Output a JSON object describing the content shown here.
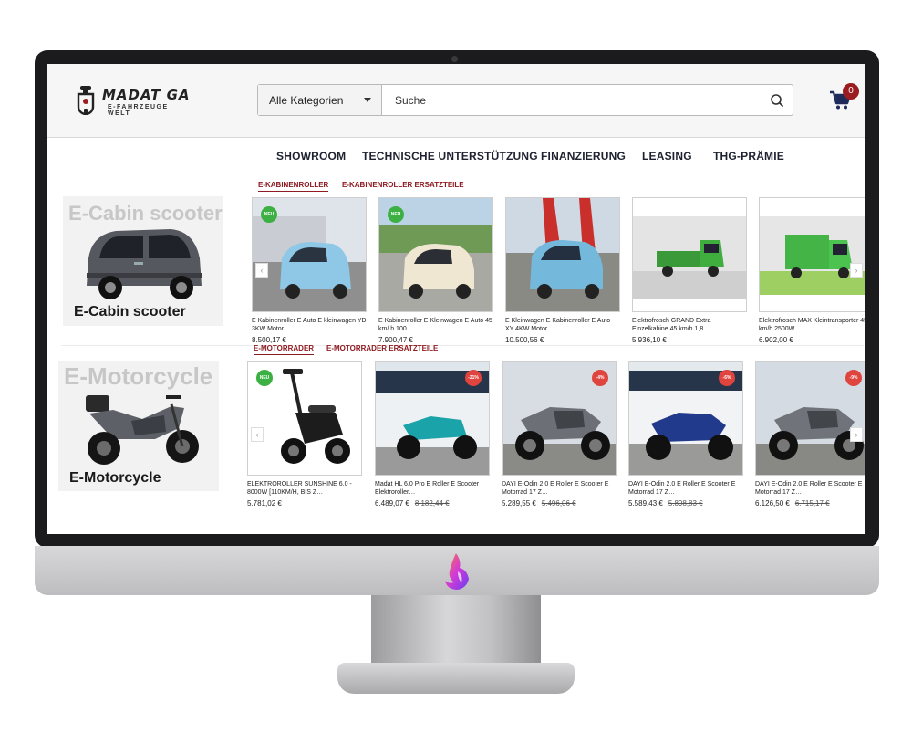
{
  "brand": {
    "name": "MADAT GA",
    "tagline": "E-FAHRZEUGE WELT",
    "accent": "#9b1c20"
  },
  "search": {
    "category_selected": "Alle Kategorien",
    "placeholder": "Suche",
    "icon": "search-icon"
  },
  "cart": {
    "icon": "cart-icon",
    "count": "0"
  },
  "nav": {
    "items": [
      {
        "label": "SHOWROOM"
      },
      {
        "label": "TECHNISCHE UNTERSTÜTZUNG"
      },
      {
        "label": "FINANZIERUNG"
      },
      {
        "label": "LEASING"
      },
      {
        "label": "THG-PRÄMIE"
      }
    ]
  },
  "sections": [
    {
      "banner_title_faded": "E-Cabin scooter",
      "banner_label": "E-Cabin scooter",
      "tabs": [
        {
          "label": "E-KABINENROLLER",
          "active": true
        },
        {
          "label": "E-KABINENROLLER ERSATZTEILE",
          "active": false
        }
      ],
      "products": [
        {
          "title": "E Kabinenroller E Auto E kleinwagen YD 3KW Motor…",
          "price": "8.500,17 €",
          "old_price": "",
          "badge": "NEU"
        },
        {
          "title": "E Kabinenroller E Kleinwagen E Auto 45 km/ h 100…",
          "price": "7.900,47 €",
          "old_price": "",
          "badge": "NEU"
        },
        {
          "title": "E Kleinwagen E Kabinenroller E Auto XY 4KW Motor…",
          "price": "10.500,56 €",
          "old_price": "",
          "badge": ""
        },
        {
          "title": "Elektrofrosch GRAND Extra Einzelkabine 45 km/h 1,8…",
          "price": "5.936,10 €",
          "old_price": "",
          "badge": ""
        },
        {
          "title": "Elektrofrosch MAX Kleintransporter 45 km/h 2500W",
          "price": "6.902,00 €",
          "old_price": "",
          "badge": ""
        }
      ]
    },
    {
      "banner_title_faded": "E-Motorcycle",
      "banner_label": "E-Motorcycle",
      "tabs": [
        {
          "label": "E-MOTORRADER",
          "active": true
        },
        {
          "label": "E-MOTORRADER ERSATZTEILE",
          "active": false
        }
      ],
      "products": [
        {
          "title": "ELEKTROROLLER SUNSHINE 6.0 - 8000W [110KM/H, BIS Z…",
          "price": "5.781,02 €",
          "old_price": "",
          "badge": "NEU"
        },
        {
          "title": "Madat HL 6.0 Pro E Roller E Scooter Elektroroller…",
          "price": "6.489,07 €",
          "old_price": "8.182,44 €",
          "badge": "-21%"
        },
        {
          "title": "DAYI E-Odin 2.0 E Roller E Scooter E Motorrad 17 Z…",
          "price": "5.289,55 €",
          "old_price": "5.496,06 €",
          "badge": "-4%"
        },
        {
          "title": "DAYI E-Odin 2.0 E Roller E Scooter E Motorrad 17 Z…",
          "price": "5.589,43 €",
          "old_price": "5.898,83 €",
          "badge": "-6%"
        },
        {
          "title": "DAYI E-Odin 2.0 E Roller E Scooter E Motorrad 17 Z…",
          "price": "6.126,50 €",
          "old_price": "6.715,17 €",
          "badge": "-9%"
        }
      ]
    }
  ]
}
